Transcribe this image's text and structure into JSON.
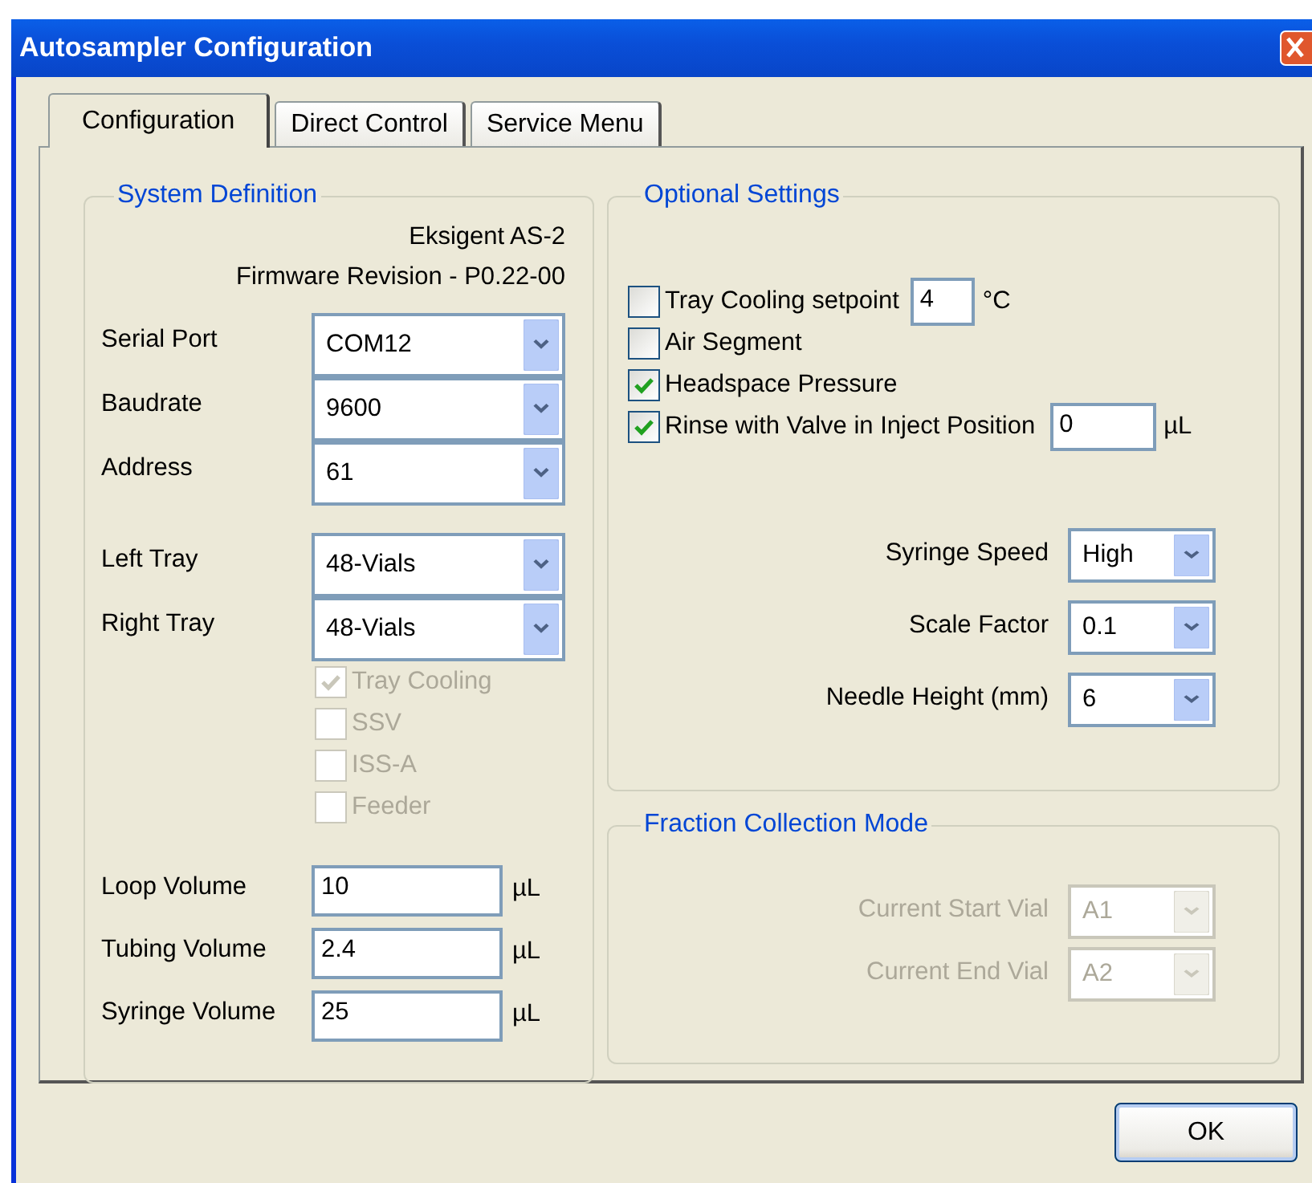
{
  "window": {
    "title": "Autosampler Configuration"
  },
  "tabs": [
    {
      "label": "Configuration",
      "selected": true
    },
    {
      "label": "Direct Control",
      "selected": false
    },
    {
      "label": "Service Menu",
      "selected": false
    }
  ],
  "system_definition": {
    "title": "System Definition",
    "device": "Eksigent AS-2",
    "firmware": "Firmware Revision - P0.22-00",
    "connection": [
      {
        "label": "Serial Port",
        "value": "COM12"
      },
      {
        "label": "Baudrate",
        "value": "9600"
      },
      {
        "label": "Address",
        "value": "61"
      }
    ],
    "trays": [
      {
        "label": "Left Tray",
        "value": "48-Vials"
      },
      {
        "label": "Right Tray",
        "value": "48-Vials"
      }
    ],
    "options": [
      {
        "label": "Tray Cooling",
        "checked": true,
        "disabled": true
      },
      {
        "label": "SSV",
        "checked": false,
        "disabled": true
      },
      {
        "label": "ISS-A",
        "checked": false,
        "disabled": true
      },
      {
        "label": "Feeder",
        "checked": false,
        "disabled": true
      }
    ],
    "volumes": [
      {
        "label": "Loop Volume",
        "value": "10",
        "unit": "µL"
      },
      {
        "label": "Tubing Volume",
        "value": "2.4",
        "unit": "µL"
      },
      {
        "label": "Syringe Volume",
        "value": "25",
        "unit": "µL"
      }
    ]
  },
  "optional_settings": {
    "title": "Optional Settings",
    "checkboxes": [
      {
        "label": "Tray Cooling setpoint",
        "checked": false,
        "field": {
          "value": "4",
          "unit": "°C"
        }
      },
      {
        "label": "Air Segment",
        "checked": false
      },
      {
        "label": "Headspace Pressure",
        "checked": true
      },
      {
        "label": "Rinse with Valve in Inject Position",
        "checked": true,
        "field": {
          "value": "0",
          "unit": "µL"
        }
      }
    ],
    "selects": [
      {
        "label": "Syringe Speed",
        "value": "High"
      },
      {
        "label": "Scale Factor",
        "value": "0.1"
      },
      {
        "label": "Needle Height (mm)",
        "value": "6"
      }
    ]
  },
  "fraction_collection": {
    "title": "Fraction Collection Mode",
    "selects": [
      {
        "label": "Current Start Vial",
        "value": "A1",
        "disabled": true
      },
      {
        "label": "Current End Vial",
        "value": "A2",
        "disabled": true
      }
    ]
  },
  "buttons": [
    "OK"
  ]
}
